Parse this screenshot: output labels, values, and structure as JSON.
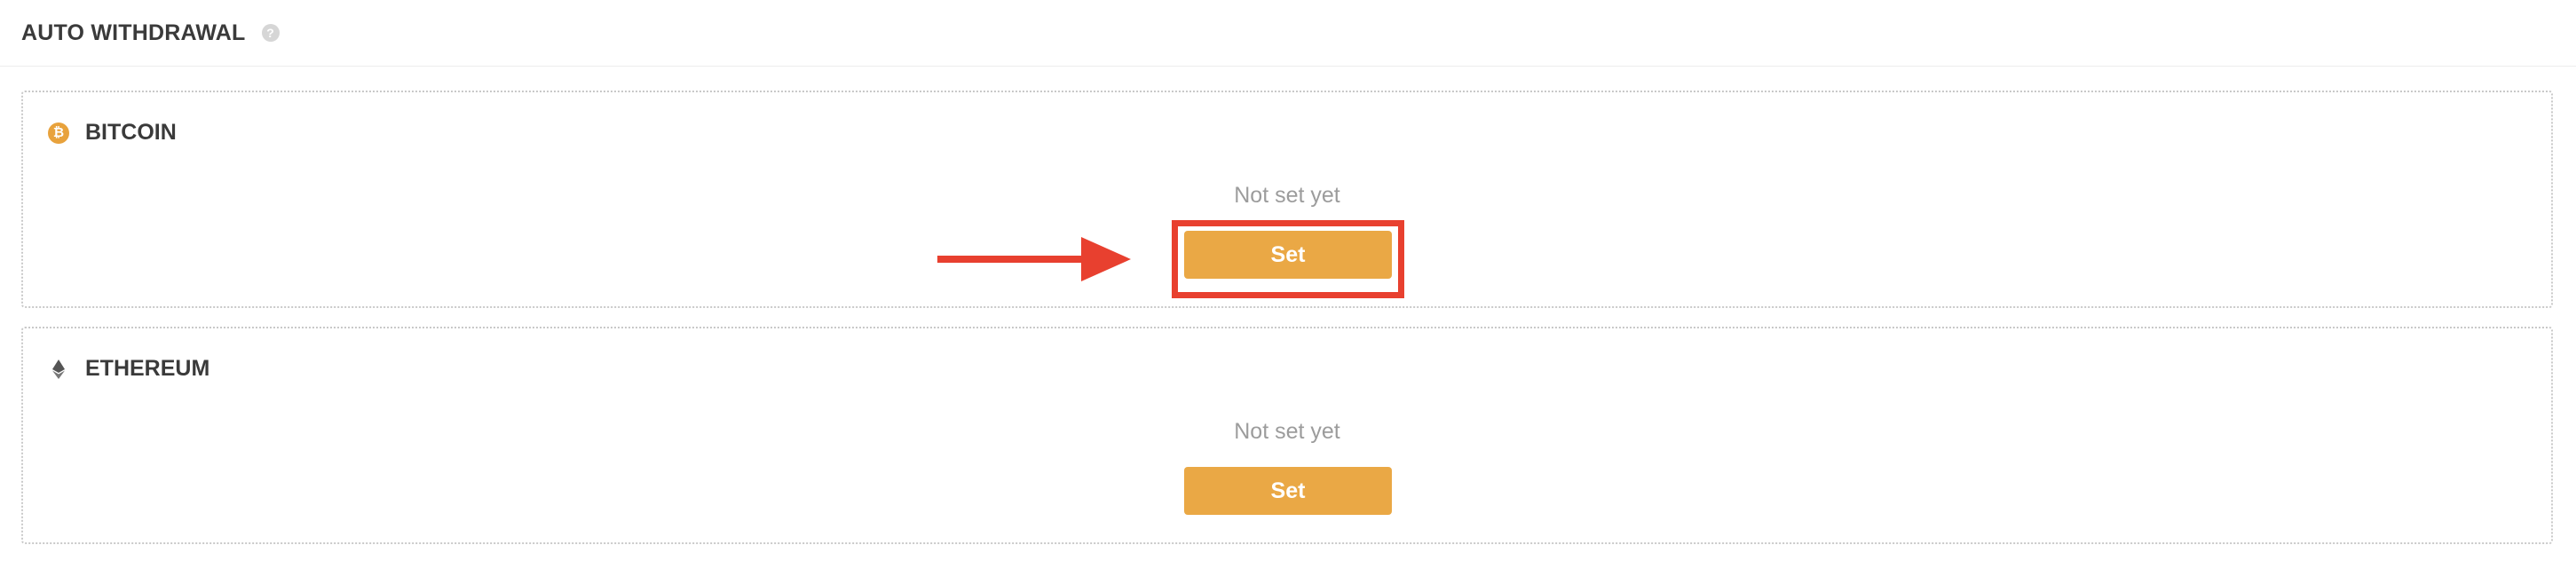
{
  "header": {
    "title": "AUTO WITHDRAWAL",
    "help_icon": "question-circle-icon",
    "help_glyph": "?"
  },
  "wallets": [
    {
      "coin": "BITCOIN",
      "icon": "bitcoin-icon",
      "icon_glyph": "₿",
      "status": "Not set yet",
      "button_label": "Set",
      "highlighted": true
    },
    {
      "coin": "ETHEREUM",
      "icon": "ethereum-icon",
      "icon_glyph": "",
      "status": "Not set yet",
      "button_label": "Set",
      "highlighted": false
    }
  ],
  "colors": {
    "accent": "#eaa845",
    "annotation": "#e8402f",
    "bitcoin": "#e8a23c",
    "status_text": "#9c9c9c"
  }
}
